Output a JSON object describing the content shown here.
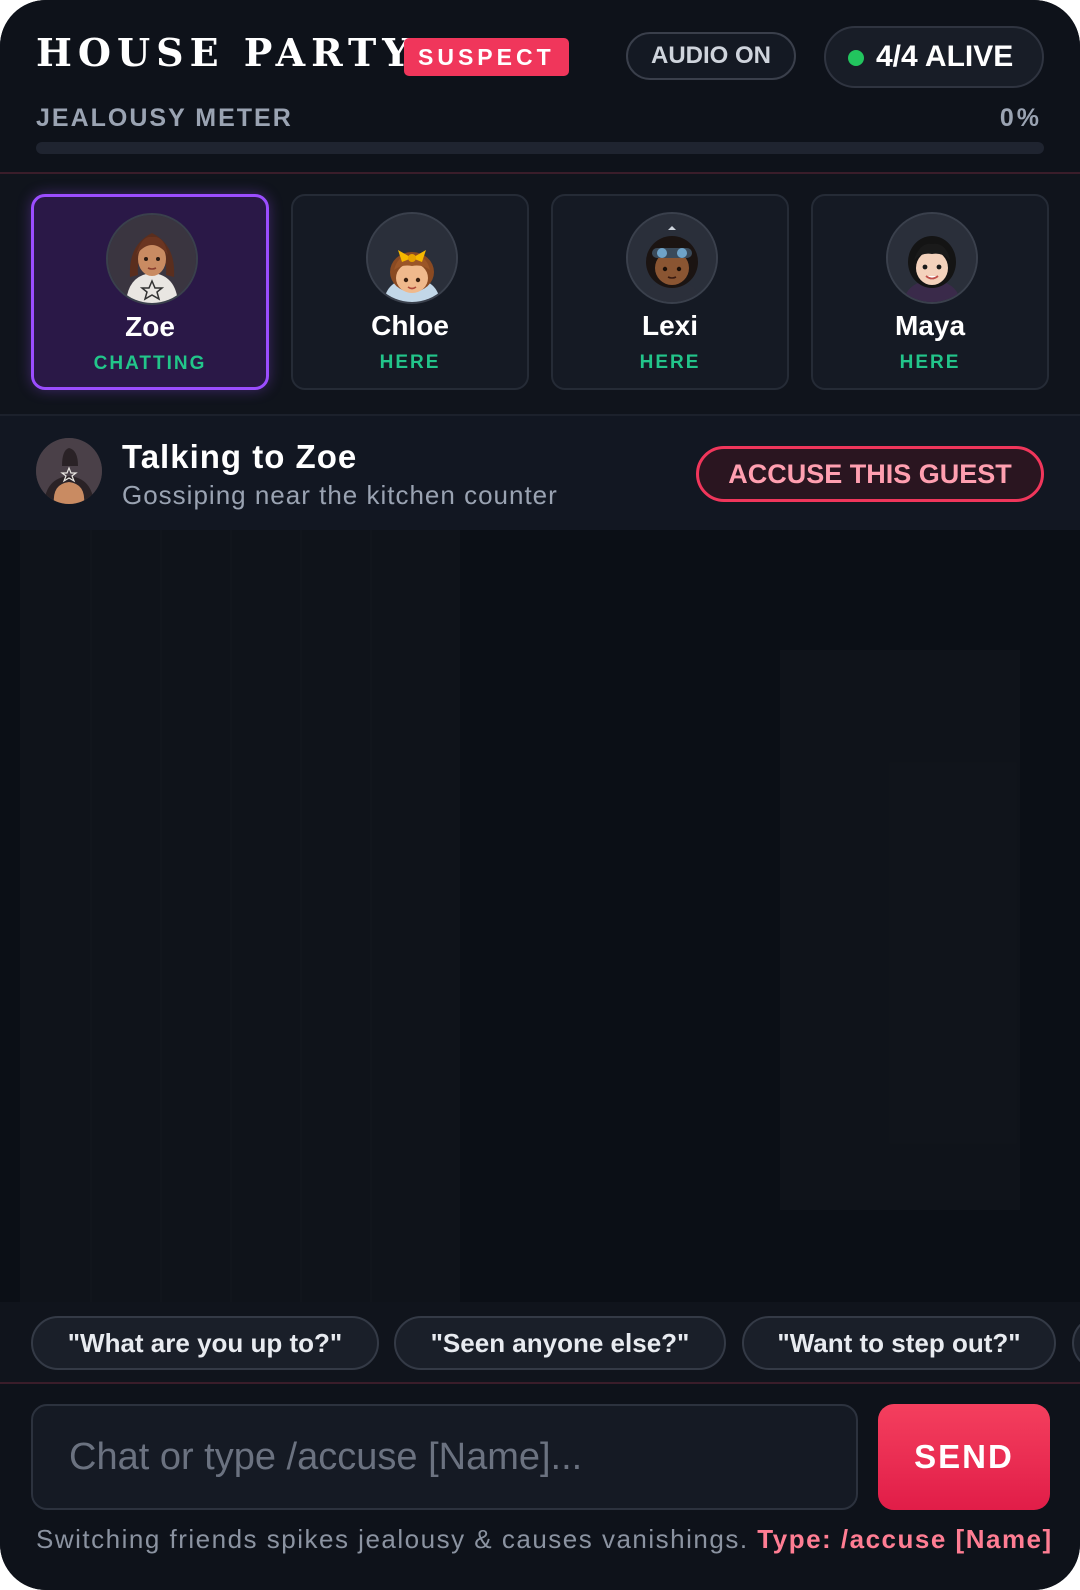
{
  "header": {
    "title": "HOUSE PARTY",
    "badge": "SUSPECT",
    "audio_label": "AUDIO ON",
    "alive_label": "4/4 ALIVE"
  },
  "meter": {
    "label": "JEALOUSY METER",
    "value_label": "0%",
    "value_percent": 0
  },
  "guests": [
    {
      "name": "Zoe",
      "status": "CHATTING",
      "active": true
    },
    {
      "name": "Chloe",
      "status": "HERE",
      "active": false
    },
    {
      "name": "Lexi",
      "status": "HERE",
      "active": false
    },
    {
      "name": "Maya",
      "status": "HERE",
      "active": false
    }
  ],
  "talk": {
    "title": "Talking to Zoe",
    "subtitle": "Gossiping near the kitchen counter",
    "accuse_label": "ACCUSE THIS GUEST"
  },
  "quick_replies": [
    "\"What are you up to?\"",
    "\"Seen anyone else?\"",
    "\"Want to step out?\""
  ],
  "input": {
    "placeholder": "Chat or type /accuse [Name]...",
    "send_label": "SEND"
  },
  "hint": {
    "text": "Switching friends spikes jealousy & causes vanishings.",
    "command": "Type: /accuse [Name]"
  },
  "colors": {
    "accent": "#f0365b",
    "active_purple": "#9b4dff",
    "status_green": "#22c58a",
    "alive_dot": "#22c55e"
  }
}
